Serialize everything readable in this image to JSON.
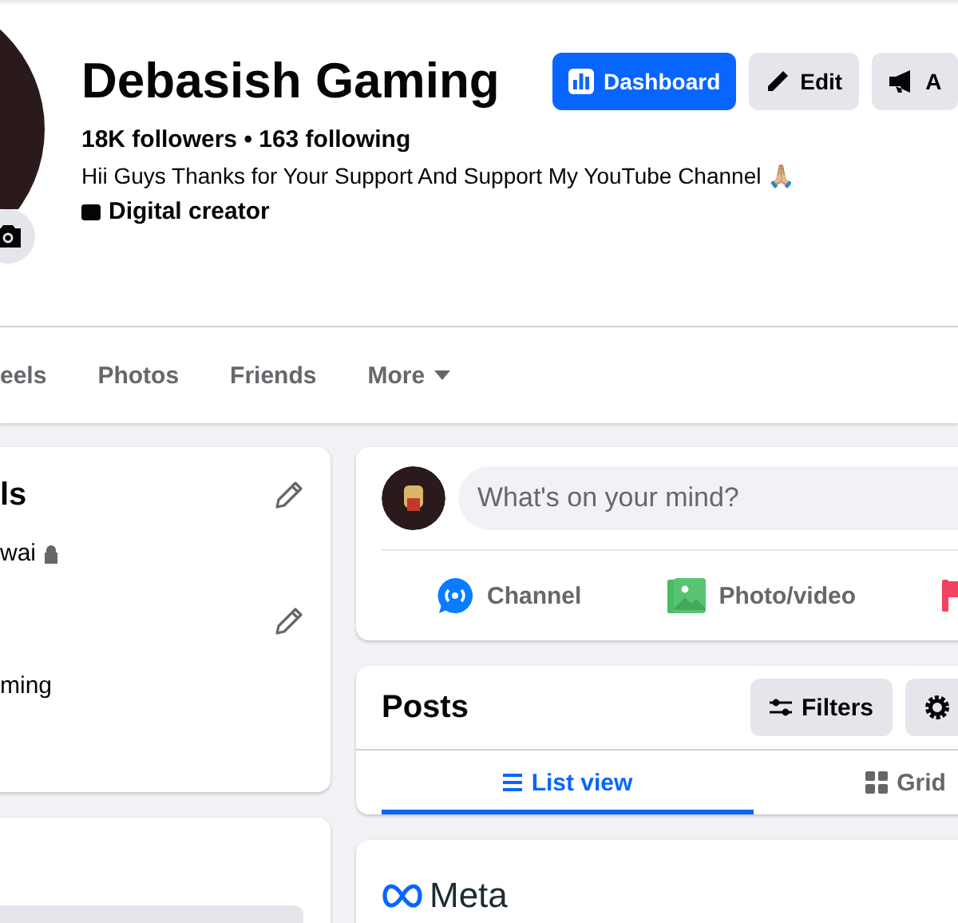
{
  "profile": {
    "name": "Debasish Gaming",
    "stats": "18K followers • 163 following",
    "bio": "Hii Guys Thanks for Your Support And Support My YouTube Channel 🙏🏼",
    "category": "Digital creator"
  },
  "header_buttons": [
    {
      "label": "Dashboard",
      "kind": "dashboard"
    },
    {
      "label": "Edit",
      "kind": "edit"
    },
    {
      "label": "A",
      "kind": "ad"
    }
  ],
  "tabs": [
    {
      "label": "eels",
      "selected": false,
      "kind": "link"
    },
    {
      "label": "Photos",
      "selected": false,
      "kind": "link"
    },
    {
      "label": "Friends",
      "selected": false,
      "kind": "link"
    },
    {
      "label": "More",
      "selected": false,
      "kind": "menu"
    }
  ],
  "intro_card": {
    "sections": [
      {
        "heading": "ls",
        "lines": [
          {
            "text": "wai",
            "locked": true
          }
        ]
      },
      {
        "lines": [
          {
            "text": "ming",
            "locked": false
          }
        ]
      }
    ]
  },
  "composer": {
    "placeholder": "What's on your mind?",
    "actions": [
      {
        "label": "Channel",
        "kind": "live"
      },
      {
        "label": "Photo/video",
        "kind": "photo"
      },
      {
        "kind": "event"
      }
    ]
  },
  "posts": {
    "title": "Posts",
    "buttons": [
      {
        "label": "Filters",
        "kind": "filters"
      },
      {
        "kind": "settings"
      }
    ],
    "views": [
      {
        "label": "List view",
        "selected": true,
        "kind": "list"
      },
      {
        "label": "Grid",
        "selected": false,
        "kind": "grid"
      }
    ]
  },
  "ad_card": {
    "brand": "Meta"
  }
}
